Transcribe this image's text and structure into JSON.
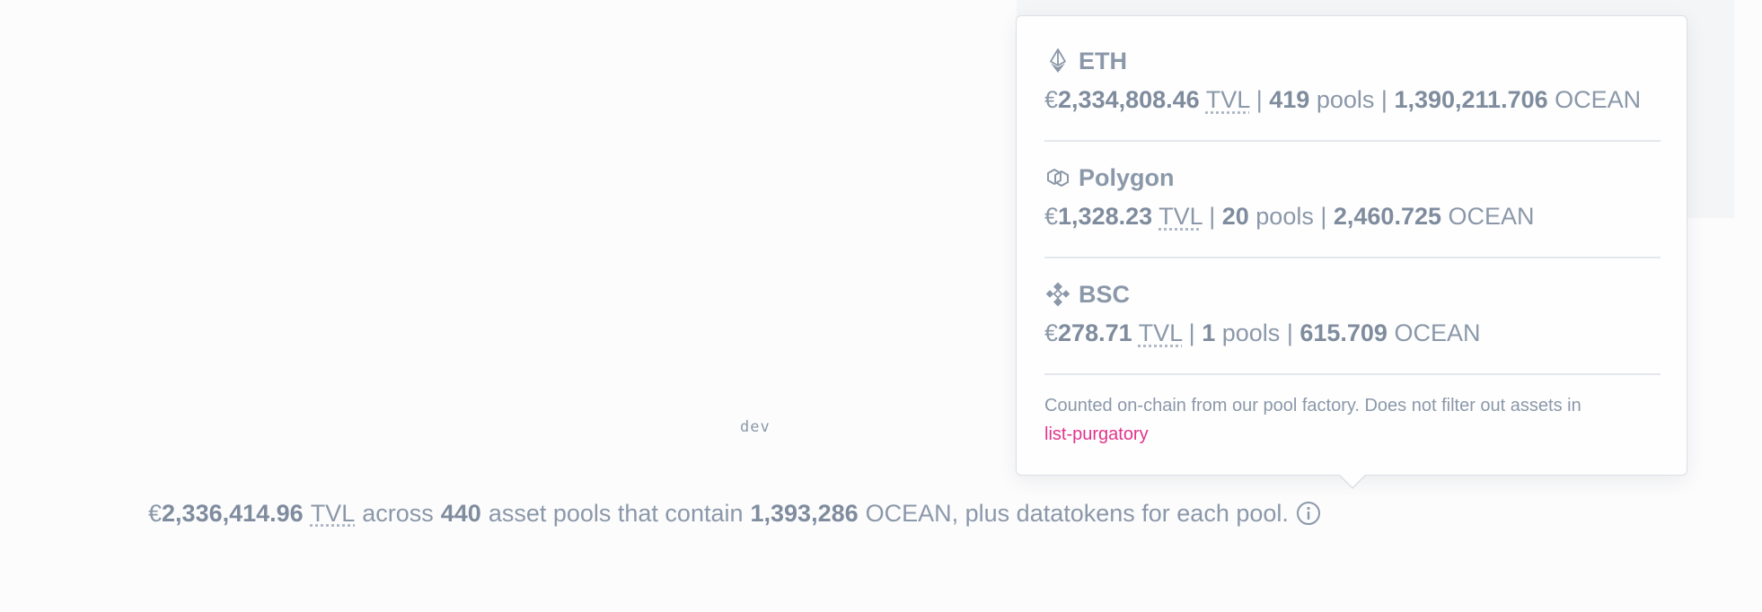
{
  "dev_label": "dev",
  "summary": {
    "currency": "€",
    "tvl_value": "2,336,414.96",
    "tvl_label": "TVL",
    "across_text": "across",
    "pool_count": "440",
    "pools_text": "asset pools that contain",
    "ocean_amount": "1,393,286",
    "ocean_text": "OCEAN, plus datatokens for each pool.",
    "info_icon": "info-circle-icon"
  },
  "tooltip": {
    "networks": [
      {
        "name": "ETH",
        "icon": "ethereum-icon",
        "currency": "€",
        "tvl": "2,334,808.46",
        "tvl_label": "TVL",
        "pools": "419",
        "pools_label": "pools",
        "ocean": "1,390,211.706",
        "ocean_label": "OCEAN"
      },
      {
        "name": "Polygon",
        "icon": "polygon-icon",
        "currency": "€",
        "tvl": "1,328.23",
        "tvl_label": "TVL",
        "pools": "20",
        "pools_label": "pools",
        "ocean": "2,460.725",
        "ocean_label": "OCEAN"
      },
      {
        "name": "BSC",
        "icon": "binance-icon",
        "currency": "€",
        "tvl": "278.71",
        "tvl_label": "TVL",
        "pools": "1",
        "pools_label": "pools",
        "ocean": "615.709",
        "ocean_label": "OCEAN"
      }
    ],
    "separator": "|",
    "footnote_text": "Counted on-chain from our pool factory. Does not filter out assets in",
    "footnote_link": "list-purgatory"
  },
  "colors": {
    "text": "#8b98a9",
    "link": "#e2348b",
    "background": "#fcfcfd"
  }
}
